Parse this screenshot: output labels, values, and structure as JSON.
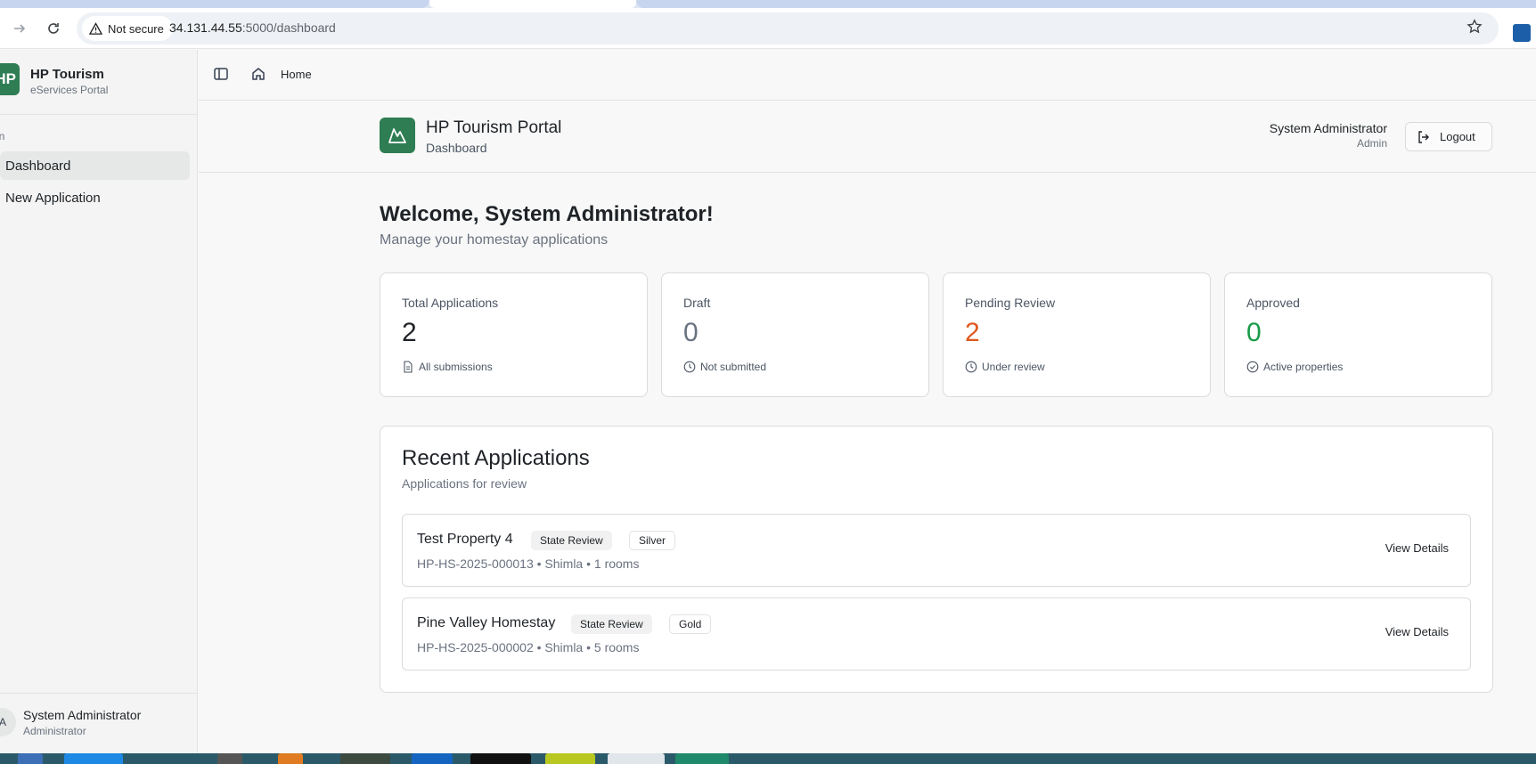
{
  "browser": {
    "security_label": "Not secure",
    "url_host": "34.131.44.55",
    "url_path": ":5000/dashboard"
  },
  "sidebar": {
    "brand_logo": "HP",
    "brand_name": "HP Tourism",
    "brand_sub": "eServices Portal",
    "group_label": "in",
    "items": [
      {
        "label": "Dashboard",
        "active": true
      },
      {
        "label": "New Application",
        "active": false
      }
    ],
    "footer": {
      "avatar": "A",
      "name": "System Administrator",
      "role": "Administrator"
    }
  },
  "topbar": {
    "home_label": "Home"
  },
  "header": {
    "title": "HP Tourism Portal",
    "subtitle": "Dashboard",
    "user_name": "System Administrator",
    "user_role": "Admin",
    "logout_label": "Logout"
  },
  "welcome": {
    "title": "Welcome, System Administrator!",
    "subtitle": "Manage your homestay applications"
  },
  "stats": [
    {
      "label": "Total Applications",
      "value": "2",
      "note": "All submissions",
      "color": "#1f2328",
      "icon": "file-icon"
    },
    {
      "label": "Draft",
      "value": "0",
      "note": "Not submitted",
      "color": "#6b7280",
      "icon": "clock-icon"
    },
    {
      "label": "Pending Review",
      "value": "2",
      "note": "Under review",
      "color": "#e0581d",
      "icon": "clock-icon"
    },
    {
      "label": "Approved",
      "value": "0",
      "note": "Active properties",
      "color": "#1a9a4a",
      "icon": "check-circle-icon"
    }
  ],
  "recent": {
    "title": "Recent Applications",
    "subtitle": "Applications for review",
    "view_label": "View Details",
    "rows": [
      {
        "name": "Test Property 4",
        "status": "State Review",
        "tier": "Silver",
        "meta": "HP-HS-2025-000013 • Shimla • 1 rooms"
      },
      {
        "name": "Pine Valley Homestay",
        "status": "State Review",
        "tier": "Gold",
        "meta": "HP-HS-2025-000002 • Shimla • 5 rooms"
      }
    ]
  },
  "colors": {
    "brand": "#2e7d53",
    "pending": "#e0581d",
    "approved": "#1a9a4a"
  }
}
